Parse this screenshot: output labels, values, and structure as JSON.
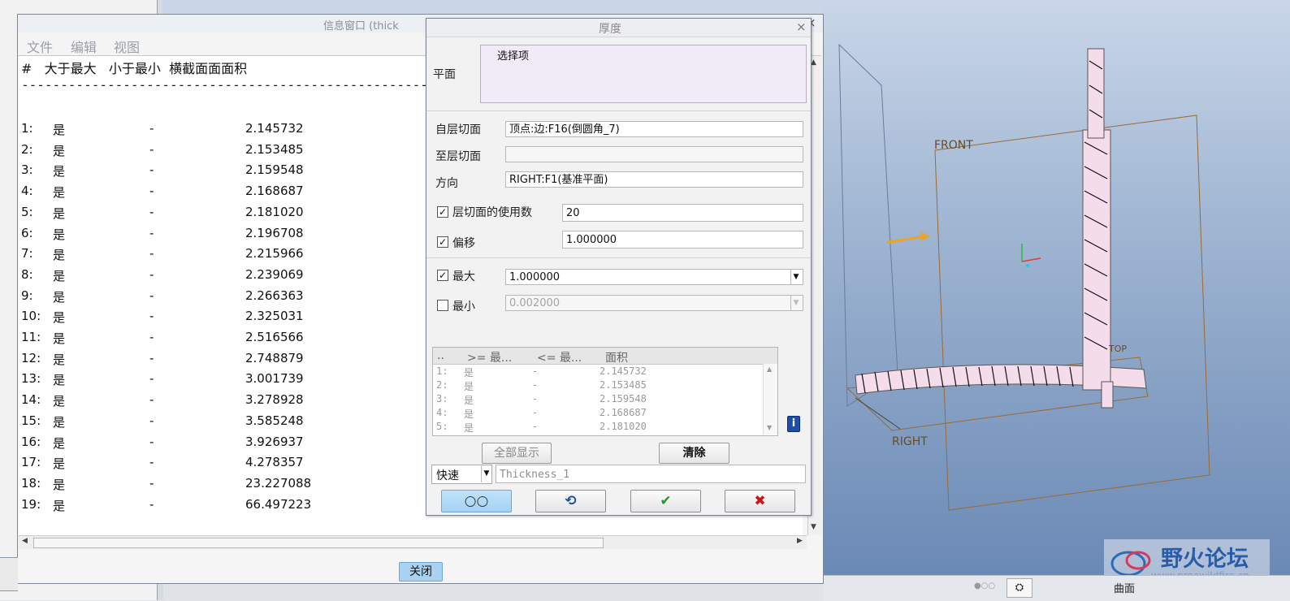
{
  "info_window": {
    "title": "信息窗口 (thick",
    "close_x": "×",
    "menu": [
      "文件",
      "编辑",
      "视图"
    ],
    "header": "#   大于最大   小于最小  横截面面面积",
    "dashes": "------------------------------------------------------------------",
    "rows": [
      {
        "n": "1:",
        "yes": "是",
        "dash": "-",
        "area": "2.145732"
      },
      {
        "n": "2:",
        "yes": "是",
        "dash": "-",
        "area": "2.153485"
      },
      {
        "n": "3:",
        "yes": "是",
        "dash": "-",
        "area": "2.159548"
      },
      {
        "n": "4:",
        "yes": "是",
        "dash": "-",
        "area": "2.168687"
      },
      {
        "n": "5:",
        "yes": "是",
        "dash": "-",
        "area": "2.181020"
      },
      {
        "n": "6:",
        "yes": "是",
        "dash": "-",
        "area": "2.196708"
      },
      {
        "n": "7:",
        "yes": "是",
        "dash": "-",
        "area": "2.215966"
      },
      {
        "n": "8:",
        "yes": "是",
        "dash": "-",
        "area": "2.239069"
      },
      {
        "n": "9:",
        "yes": "是",
        "dash": "-",
        "area": "2.266363"
      },
      {
        "n": "10:",
        "yes": "是",
        "dash": "-",
        "area": "2.325031"
      },
      {
        "n": "11:",
        "yes": "是",
        "dash": "-",
        "area": "2.516566"
      },
      {
        "n": "12:",
        "yes": "是",
        "dash": "-",
        "area": "2.748879"
      },
      {
        "n": "13:",
        "yes": "是",
        "dash": "-",
        "area": "3.001739"
      },
      {
        "n": "14:",
        "yes": "是",
        "dash": "-",
        "area": "3.278928"
      },
      {
        "n": "15:",
        "yes": "是",
        "dash": "-",
        "area": "3.585248"
      },
      {
        "n": "16:",
        "yes": "是",
        "dash": "-",
        "area": "3.926937"
      },
      {
        "n": "17:",
        "yes": "是",
        "dash": "-",
        "area": "4.278357"
      },
      {
        "n": "18:",
        "yes": "是",
        "dash": "-",
        "area": "23.227088"
      },
      {
        "n": "19:",
        "yes": "是",
        "dash": "-",
        "area": "66.497223"
      }
    ],
    "close_button": "关闭"
  },
  "dialog": {
    "title": "厚度",
    "close_x": "×",
    "plane_label": "平面",
    "plane_value": "选择项",
    "from_label": "自层切面",
    "from_value": "顶点:边:F16(倒圆角_7)",
    "to_label": "至层切面",
    "to_value": "",
    "direction_label": "方向",
    "direction_value": "RIGHT:F1(基准平面)",
    "slice_count_label": "层切面的使用数",
    "slice_count_value": "20",
    "slice_count_checked": true,
    "offset_label": "偏移",
    "offset_value": "1.000000",
    "offset_checked": true,
    "max_label": "最大",
    "max_value": "1.000000",
    "max_checked": true,
    "min_label": "最小",
    "min_value": "0.002000",
    "min_checked": false,
    "table_headers": [
      "..",
      ">= 最...",
      "<= 最...",
      "面积"
    ],
    "table_rows": [
      {
        "n": "1:",
        "yes": "是",
        "dash": "-",
        "area": "2.145732"
      },
      {
        "n": "2:",
        "yes": "是",
        "dash": "-",
        "area": "2.153485"
      },
      {
        "n": "3:",
        "yes": "是",
        "dash": "-",
        "area": "2.159548"
      },
      {
        "n": "4:",
        "yes": "是",
        "dash": "-",
        "area": "2.168687"
      },
      {
        "n": "5:",
        "yes": "是",
        "dash": "-",
        "area": "2.181020"
      }
    ],
    "show_all_button": "全部显示",
    "clear_button": "清除",
    "mode_value": "快速",
    "name_value": "Thickness_1"
  },
  "viewport": {
    "labels": {
      "front": "FRONT",
      "right": "RIGHT",
      "top": "TOP"
    }
  },
  "watermark": {
    "text": "野火论坛",
    "url": "www.proewildfire.cn"
  },
  "statusbar": {
    "label": "曲面"
  },
  "colors": {
    "accent_blue": "#a9d2f2",
    "check_green": "#1a9a2a",
    "cancel_red": "#c41818",
    "model_pink": "#f3d6e8",
    "plane_orange": "#a0703a"
  }
}
